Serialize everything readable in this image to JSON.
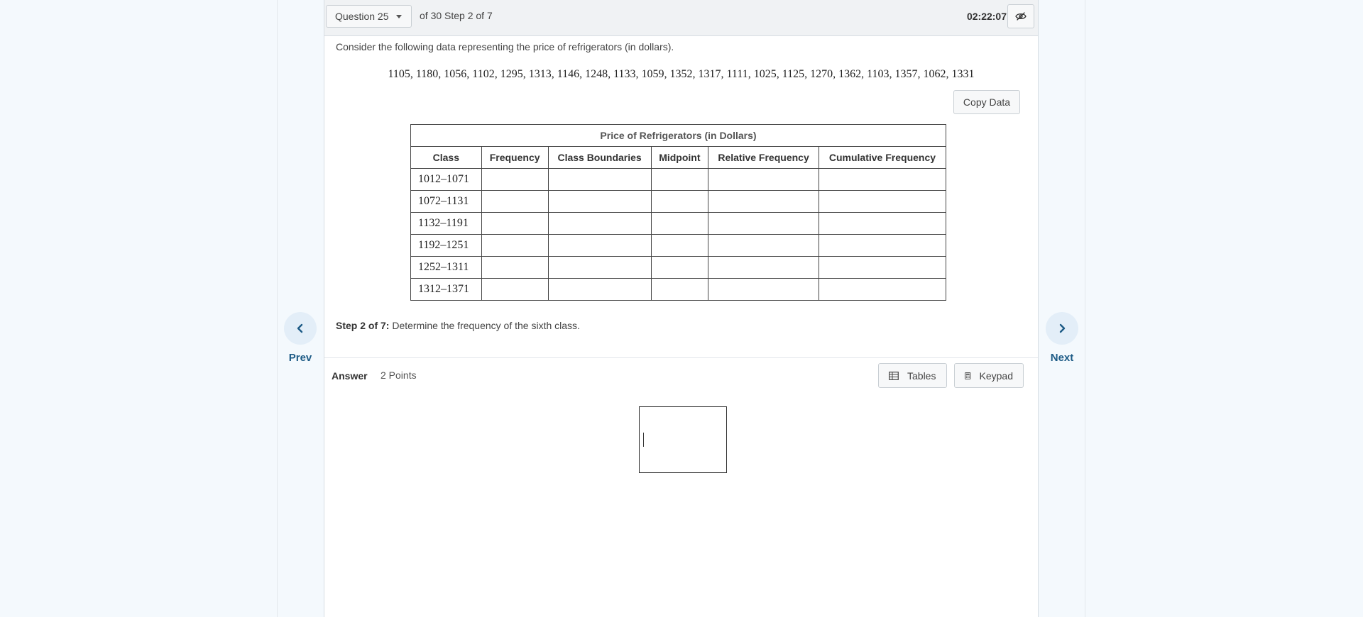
{
  "header": {
    "question_select": "Question 25",
    "progress": "of 30 Step 2 of 7",
    "timer": "02:22:07"
  },
  "problem": {
    "prompt": "Consider the following data representing the price of refrigerators (in dollars).",
    "data": "1105, 1180, 1056, 1102, 1295, 1313, 1146, 1248, 1133, 1059, 1352, 1317, 1111, 1025, 1125, 1270, 1362, 1103, 1357, 1062, 1331",
    "copy_label": "Copy Data"
  },
  "table": {
    "caption": "Price of Refrigerators (in Dollars)",
    "columns": [
      "Class",
      "Frequency",
      "Class Boundaries",
      "Midpoint",
      "Relative Frequency",
      "Cumulative Frequency"
    ],
    "classes": [
      "1012–1071",
      "1072–1131",
      "1132–1191",
      "1192–1251",
      "1252–1311",
      "1312–1371"
    ]
  },
  "step": {
    "label": "Step 2 of 7:",
    "text": "Determine the frequency of the sixth class."
  },
  "answer": {
    "label": "Answer",
    "points": "2 Points",
    "tables_label": "Tables",
    "keypad_label": "Keypad",
    "value": ""
  },
  "nav": {
    "prev": "Prev",
    "next": "Next"
  },
  "icons": {
    "prev": "chevron-left-icon",
    "next": "chevron-right-icon",
    "eye": "eye-slash-icon",
    "tables": "table-grid-icon",
    "keypad": "calculator-icon"
  },
  "colors": {
    "accent": "#1d5b86",
    "nav_circle": "#e3eef8",
    "page_bg": "#f4f9fd"
  }
}
